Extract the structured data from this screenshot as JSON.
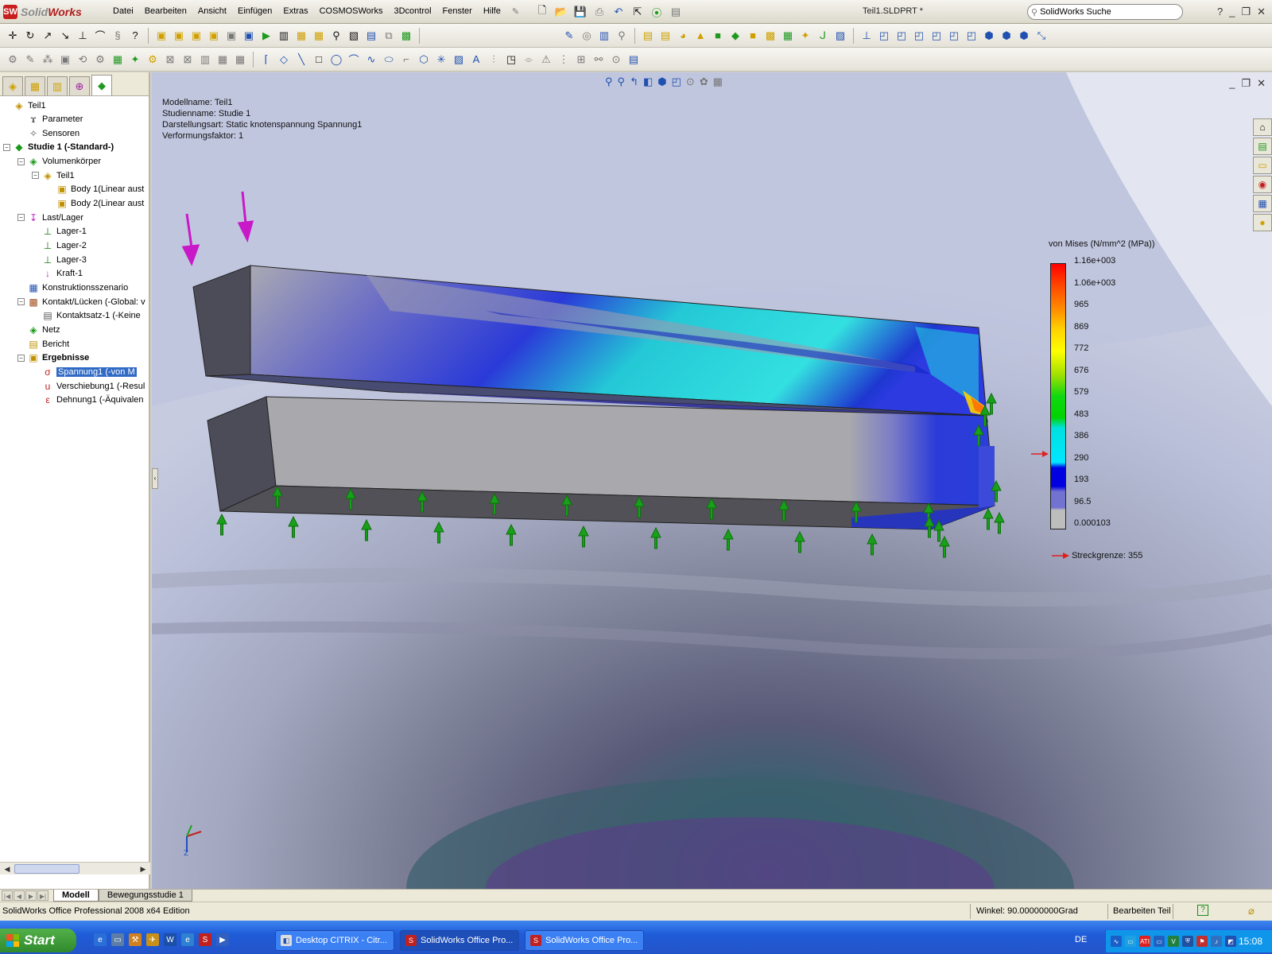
{
  "app": {
    "logo_text_a": "Solid",
    "logo_text_b": "Works",
    "document_title": "Teil1.SLDPRT *",
    "search_placeholder": "SolidWorks Suche"
  },
  "menu": [
    "Datei",
    "Bearbeiten",
    "Ansicht",
    "Einfügen",
    "Extras",
    "COSMOSWorks",
    "3Dcontrol",
    "Fenster",
    "Hilfe"
  ],
  "tree": {
    "items": [
      {
        "label": "Teil1",
        "indent": 0,
        "icon": "part-icon",
        "expander": ""
      },
      {
        "label": "Parameter",
        "indent": 1,
        "icon": "parameter-icon",
        "expander": ""
      },
      {
        "label": "Sensoren",
        "indent": 1,
        "icon": "sensor-icon",
        "expander": ""
      },
      {
        "label": "Studie 1 (-Standard-)",
        "indent": 0,
        "icon": "study-icon",
        "expander": "−",
        "bold": true
      },
      {
        "label": "Volumenkörper",
        "indent": 1,
        "icon": "solid-body-icon",
        "expander": "−"
      },
      {
        "label": "Teil1",
        "indent": 2,
        "icon": "part-icon",
        "expander": "−"
      },
      {
        "label": "Body 1(Linear aust",
        "indent": 3,
        "icon": "body-icon",
        "expander": ""
      },
      {
        "label": "Body 2(Linear aust",
        "indent": 3,
        "icon": "body-icon",
        "expander": ""
      },
      {
        "label": "Last/Lager",
        "indent": 1,
        "icon": "load-icon",
        "expander": "−"
      },
      {
        "label": "Lager-1",
        "indent": 2,
        "icon": "fixture-icon",
        "expander": ""
      },
      {
        "label": "Lager-2",
        "indent": 2,
        "icon": "fixture-icon",
        "expander": ""
      },
      {
        "label": "Lager-3",
        "indent": 2,
        "icon": "fixture-icon",
        "expander": ""
      },
      {
        "label": "Kraft-1",
        "indent": 2,
        "icon": "force-icon",
        "expander": ""
      },
      {
        "label": "Konstruktionsszenario",
        "indent": 1,
        "icon": "design-scenario-icon",
        "expander": ""
      },
      {
        "label": "Kontakt/Lücken (-Global: v",
        "indent": 1,
        "icon": "contact-icon",
        "expander": "−"
      },
      {
        "label": "Kontaktsatz-1 (-Keine",
        "indent": 2,
        "icon": "contact-set-icon",
        "expander": ""
      },
      {
        "label": "Netz",
        "indent": 1,
        "icon": "mesh-icon",
        "expander": ""
      },
      {
        "label": "Bericht",
        "indent": 1,
        "icon": "report-icon",
        "expander": ""
      },
      {
        "label": "Ergebnisse",
        "indent": 1,
        "icon": "results-folder-icon",
        "expander": "−",
        "bold": true
      },
      {
        "label": "Spannung1 (-von M",
        "indent": 2,
        "icon": "stress-plot-icon",
        "expander": "",
        "selected": true
      },
      {
        "label": "Verschiebung1 (-Resul",
        "indent": 2,
        "icon": "displacement-plot-icon",
        "expander": ""
      },
      {
        "label": "Dehnung1 (-Äquivalen",
        "indent": 2,
        "icon": "strain-plot-icon",
        "expander": ""
      }
    ]
  },
  "study_info": {
    "model": "Modellname: Teil1",
    "study": "Studienname: Studie 1",
    "plot_type": "Darstellungsart: Static knotenspannung Spannung1",
    "deformation": "Verformungsfaktor: 1"
  },
  "legend": {
    "title": "von Mises (N/mm^2 (MPa))",
    "labels": [
      "1.16e+003",
      "1.06e+003",
      "965",
      "869",
      "772",
      "676",
      "579",
      "483",
      "386",
      "290",
      "193",
      "96.5",
      "0.000103"
    ],
    "colors": [
      "#ff0000",
      "#ff4a00",
      "#ff9000",
      "#ffd800",
      "#ffff00",
      "#a0e000",
      "#38d020",
      "#00d400",
      "#00e0e0",
      "#00e8ff",
      "#0000e0",
      "#7070d0",
      "#bcbcbc"
    ],
    "yield_label": "Streckgrenze: 355",
    "yield_marker_color": "#e02020"
  },
  "bottom_tabs": [
    "Modell",
    "Bewegungsstudie 1"
  ],
  "status": {
    "left": "SolidWorks Office Professional 2008 x64 Edition",
    "angle": "Winkel: 90.00000000Grad",
    "mode": "Bearbeiten Teil"
  },
  "taskbar": {
    "start_label": "Start",
    "tasks": [
      "Desktop CITRIX - Citr...",
      "SolidWorks Office Pro...",
      "SolidWorks Office Pro..."
    ],
    "language": "DE",
    "clock": "15:08"
  }
}
